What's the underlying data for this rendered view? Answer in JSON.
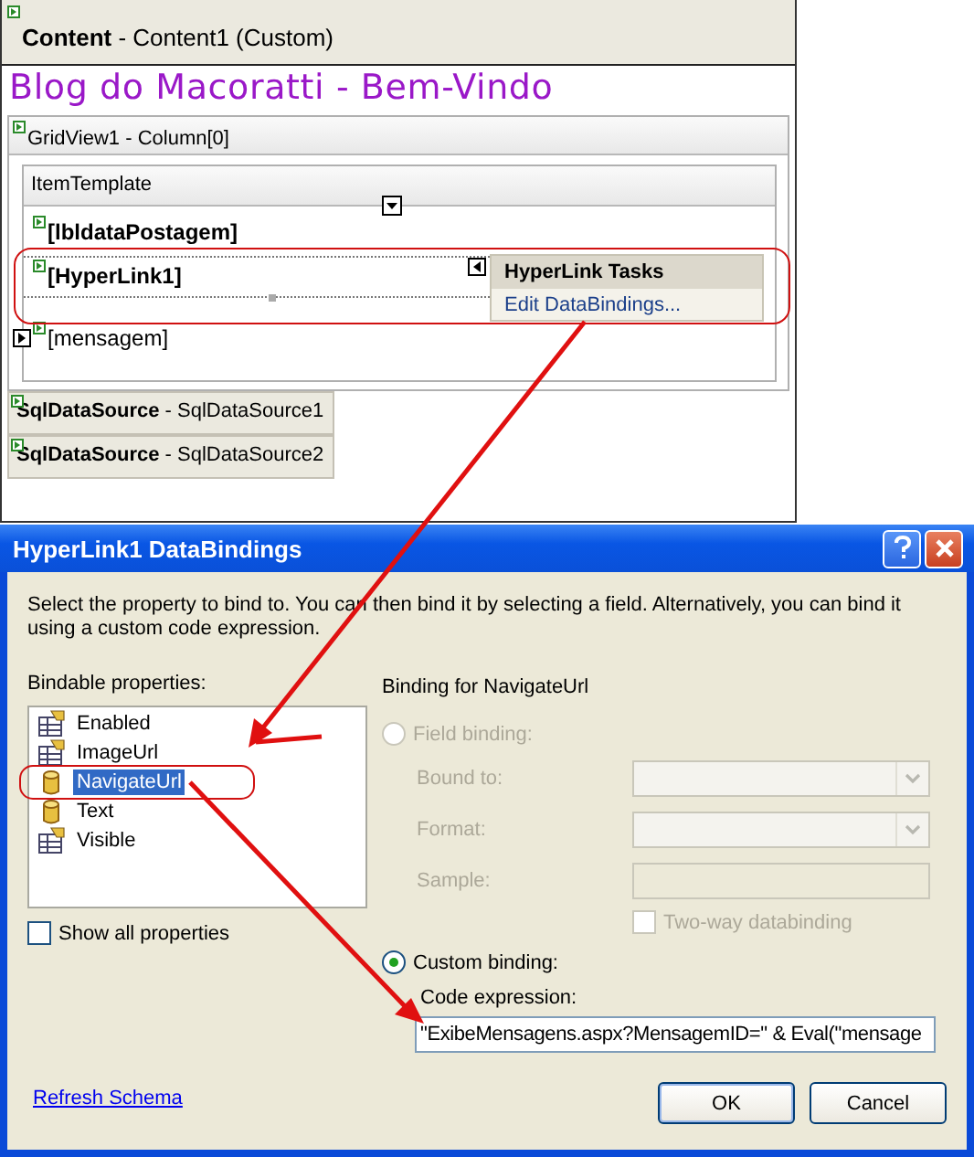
{
  "designer": {
    "content_header": {
      "type": "Content",
      "name": " - Content1 (Custom)"
    },
    "page_title": "Blog do Macoratti - Bem-Vindo",
    "gridview_header": "GridView1 - Column[0]",
    "template_header": "ItemTemplate",
    "fields": [
      {
        "label": "[lbldataPostagem]",
        "kind": "bold"
      },
      {
        "label": "[HyperLink1]",
        "kind": "bold"
      },
      {
        "label": "[mensagem]",
        "kind": "plain"
      }
    ],
    "smart_tag": {
      "title": "HyperLink Tasks",
      "action": "Edit DataBindings..."
    },
    "data_sources": [
      {
        "type": "SqlDataSource",
        "name": " - SqlDataSource1"
      },
      {
        "type": "SqlDataSource",
        "name": " - SqlDataSource2"
      }
    ]
  },
  "dialog": {
    "title": "HyperLink1 DataBindings",
    "description": "Select the property to bind to. You can then bind it by selecting a field. Alternatively, you can bind it using a custom code expression.",
    "bindable_label": "Bindable properties:",
    "properties": [
      {
        "label": "Enabled",
        "kind": "property",
        "selected": false
      },
      {
        "label": "ImageUrl",
        "kind": "property",
        "selected": false
      },
      {
        "label": "NavigateUrl",
        "kind": "bound",
        "selected": true
      },
      {
        "label": "Text",
        "kind": "bound",
        "selected": false
      },
      {
        "label": "Visible",
        "kind": "property",
        "selected": false
      }
    ],
    "show_all": {
      "label": "Show all properties",
      "checked": false
    },
    "binding_for": "Binding for NavigateUrl",
    "field_binding": {
      "label": "Field binding:",
      "selected": false,
      "disabled": true
    },
    "field_rows": [
      {
        "label": "Bound to:",
        "kind": "combo"
      },
      {
        "label": "Format:",
        "kind": "combo"
      },
      {
        "label": "Sample:",
        "kind": "text"
      }
    ],
    "two_way": {
      "label": "Two-way databinding",
      "checked": false,
      "disabled": true
    },
    "custom_binding": {
      "label": "Custom binding:",
      "selected": true
    },
    "code_label": "Code expression:",
    "code_value": "\"ExibeMensagens.aspx?MensagemID=\" & Eval(\"mensage",
    "refresh_link": "Refresh Schema",
    "buttons": [
      {
        "label": "OK",
        "kind": "default"
      },
      {
        "label": "Cancel",
        "kind": "normal"
      }
    ]
  }
}
